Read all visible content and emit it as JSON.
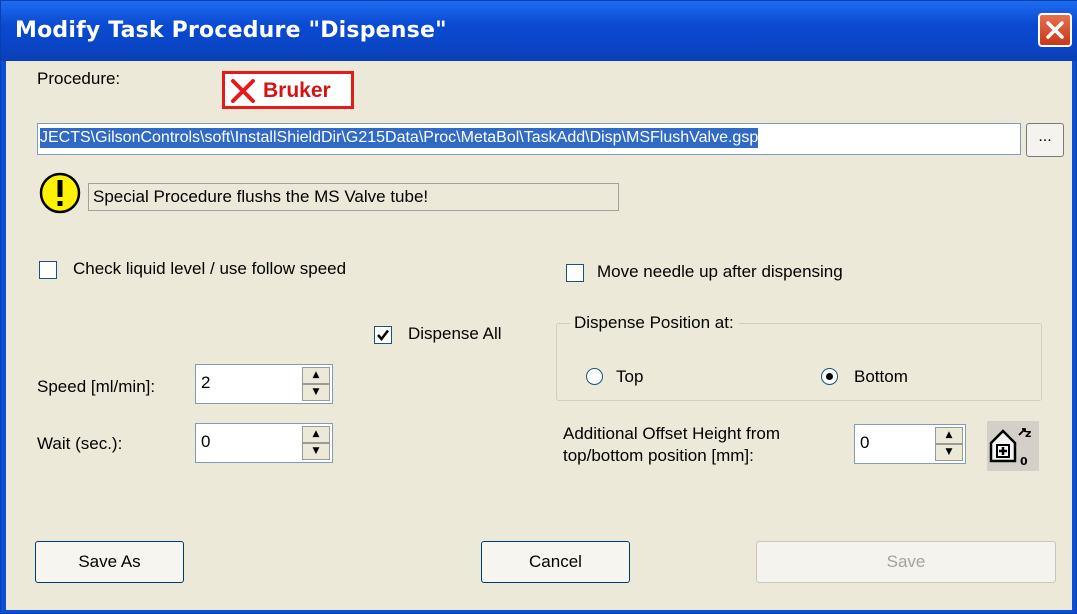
{
  "window": {
    "title": "Modify Task Procedure \"Dispense\""
  },
  "procedure": {
    "label": "Procedure:",
    "brand": "Bruker",
    "path": "JECTS\\GilsonControls\\soft\\InstallShieldDir\\G215Data\\Proc\\MetaBol\\TaskAdd\\Disp\\MSFlushValve.gsp",
    "browse_label": "...",
    "info_text": "Special Procedure flushs the MS Valve tube!"
  },
  "options": {
    "check_liquid_label": "Check liquid level / use follow speed",
    "check_liquid_checked": false,
    "move_needle_label": "Move needle up after dispensing",
    "move_needle_checked": false,
    "dispense_all_label": "Dispense All",
    "dispense_all_checked": true
  },
  "dispense_position": {
    "title": "Dispense Position at:",
    "options": [
      "Top",
      "Bottom"
    ],
    "selected": "Bottom"
  },
  "fields": {
    "speed_label": "Speed [ml/min]:",
    "speed_value": "2",
    "wait_label": "Wait (sec.):",
    "wait_value": "0",
    "offset_label_line1": "Additional Offset Height from",
    "offset_label_line2": "top/bottom position [mm]:",
    "offset_value": "0"
  },
  "buttons": {
    "save_as": "Save As",
    "cancel": "Cancel",
    "save": "Save"
  },
  "colors": {
    "title_bar": "#0a4ad1",
    "selection": "#316ac5",
    "brand": "#d41414",
    "dialog_bg": "#ece9d8"
  },
  "icons": {
    "warning": "exclamation-icon",
    "close": "close-icon",
    "offset": "home-offset-icon"
  }
}
